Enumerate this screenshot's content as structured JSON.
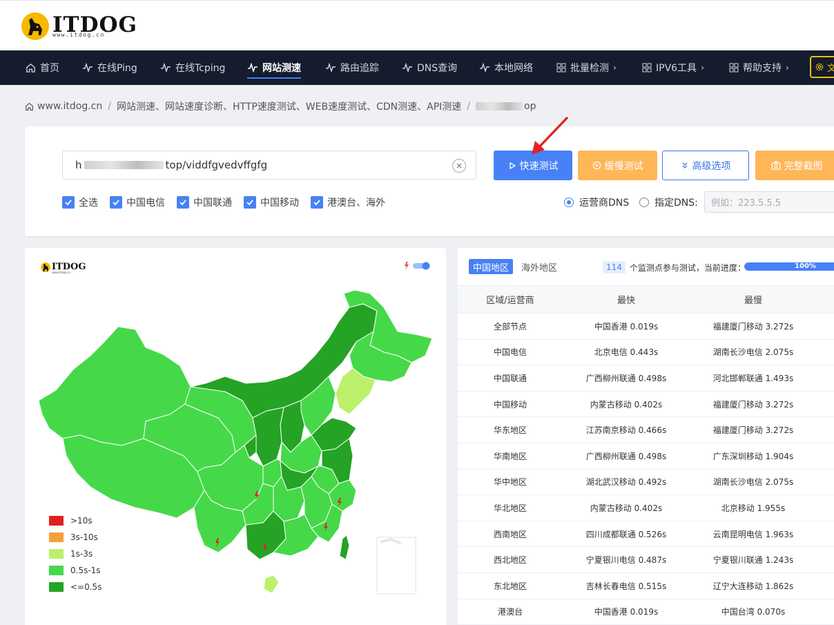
{
  "header": {
    "logo_text": "ITDOG",
    "logo_subtext": "www.itdog.cn"
  },
  "nav": {
    "items": [
      {
        "label": "首页",
        "icon": "home-icon"
      },
      {
        "label": "在线Ping",
        "icon": "pulse-icon"
      },
      {
        "label": "在线Tcping",
        "icon": "pulse-icon"
      },
      {
        "label": "网站测速",
        "icon": "pulse-icon",
        "active": true
      },
      {
        "label": "路由追踪",
        "icon": "pulse-icon"
      },
      {
        "label": "DNS查询",
        "icon": "pulse-icon"
      },
      {
        "label": "本地网络",
        "icon": "pulse-icon"
      },
      {
        "label": "批量检测",
        "icon": "grid-icon",
        "chevron": "›"
      },
      {
        "label": "IPV6工具",
        "icon": "grid-icon",
        "chevron": "›"
      },
      {
        "label": "帮助支持",
        "icon": "grid-icon",
        "chevron": "›"
      }
    ],
    "last_button_label": "文",
    "accent_color": "#f0c000"
  },
  "breadcrumb": {
    "home": "www.itdog.cn",
    "section": "网站测速、网站速度诊断、HTTP速度测试、WEB速度测试、CDN测速、API测速",
    "current_suffix": "op"
  },
  "test_form": {
    "url_prefix": "h",
    "url_visible": "top/viddfgvedvffgfg",
    "clear_icon": "close-circle-icon",
    "buttons": {
      "quick": "快速测试",
      "slow": "缓慢测试",
      "advanced": "高级选项",
      "screenshot": "完整截图"
    },
    "checkboxes": [
      "全选",
      "中国电信",
      "中国联通",
      "中国移动",
      "港澳台、海外"
    ],
    "dns": {
      "isp_label": "运营商DNS",
      "custom_label": "指定DNS:",
      "placeholder": "例如：223.5.5.5"
    }
  },
  "map": {
    "logo_text": "ITDOG",
    "logo_sub": "www.itdog.cn",
    "legend": [
      {
        "label": ">10s",
        "color": "#e01f1f"
      },
      {
        "label": "3s-10s",
        "color": "#f5a03a"
      },
      {
        "label": "1s-3s",
        "color": "#bdf06a"
      },
      {
        "label": "0.5s-1s",
        "color": "#45d949"
      },
      {
        "label": "<=0.5s",
        "color": "#25a325"
      }
    ]
  },
  "results": {
    "tabs": [
      "中国地区",
      "海外地区"
    ],
    "node_count": "114",
    "progress_text": "个监测点参与测试，当前进度：",
    "progress_value": "100%",
    "progress_fraction": 1.0,
    "columns": [
      "区域/运营商",
      "最快",
      "最慢"
    ],
    "rows": [
      [
        "全部节点",
        "中国香港 0.019s",
        "福建厦门移动 3.272s"
      ],
      [
        "中国电信",
        "北京电信 0.443s",
        "湖南长沙电信 2.075s"
      ],
      [
        "中国联通",
        "广西柳州联通 0.498s",
        "河北邯郸联通 1.493s"
      ],
      [
        "中国移动",
        "内蒙古移动 0.402s",
        "福建厦门移动 3.272s"
      ],
      [
        "华东地区",
        "江苏南京移动 0.466s",
        "福建厦门移动 3.272s"
      ],
      [
        "华南地区",
        "广西柳州联通 0.498s",
        "广东深圳移动 1.904s"
      ],
      [
        "华中地区",
        "湖北武汉移动 0.492s",
        "湖南长沙电信 2.075s"
      ],
      [
        "华北地区",
        "内蒙古移动 0.402s",
        "北京移动 1.955s"
      ],
      [
        "西南地区",
        "四川成都联通 0.526s",
        "云南昆明电信 1.963s"
      ],
      [
        "西北地区",
        "宁夏银川电信 0.487s",
        "宁夏银川联通 1.243s"
      ],
      [
        "东北地区",
        "吉林长春电信 0.515s",
        "辽宁大连移动 1.862s"
      ],
      [
        "港澳台",
        "中国香港 0.019s",
        "中国台湾 0.070s"
      ]
    ]
  }
}
